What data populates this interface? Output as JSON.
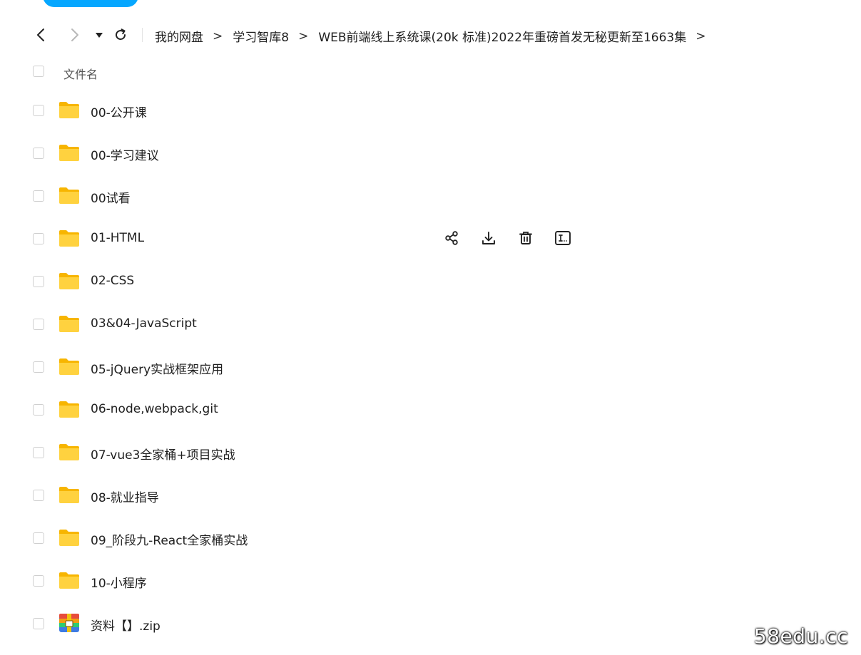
{
  "nav": {
    "back_icon": "chevron-left-icon",
    "forward_icon": "chevron-right-icon",
    "history_icon": "caret-down-icon",
    "refresh_icon": "refresh-icon"
  },
  "breadcrumb": {
    "items": [
      "我的网盘",
      "学习智库8",
      "WEB前端线上系统课(20k 标准)2022年重磅首发无秘更新至1663集"
    ],
    "separator": ">"
  },
  "list_header": {
    "name_label": "文件名"
  },
  "files": [
    {
      "name": "00-公开课",
      "type": "folder"
    },
    {
      "name": "00-学习建议",
      "type": "folder"
    },
    {
      "name": "00试看",
      "type": "folder"
    },
    {
      "name": "01-HTML",
      "type": "folder",
      "hovered": true
    },
    {
      "name": "02-CSS",
      "type": "folder"
    },
    {
      "name": "03&04-JavaScript",
      "type": "folder"
    },
    {
      "name": "05-jQuery实战框架应用",
      "type": "folder"
    },
    {
      "name": "06-node,webpack,git",
      "type": "folder"
    },
    {
      "name": "07-vue3全家桶+项目实战",
      "type": "folder"
    },
    {
      "name": "08-就业指导",
      "type": "folder"
    },
    {
      "name": "09_阶段九-React全家桶实战",
      "type": "folder"
    },
    {
      "name": "10-小程序",
      "type": "folder"
    },
    {
      "name": "资料【】.zip",
      "type": "zip"
    }
  ],
  "row_actions": [
    "share-icon",
    "download-icon",
    "delete-icon",
    "rename-icon"
  ],
  "watermark": "58edu.cc",
  "colors": {
    "accent": "#06a7ff",
    "folder": "#ffc93c",
    "text": "#1f1f1f"
  }
}
